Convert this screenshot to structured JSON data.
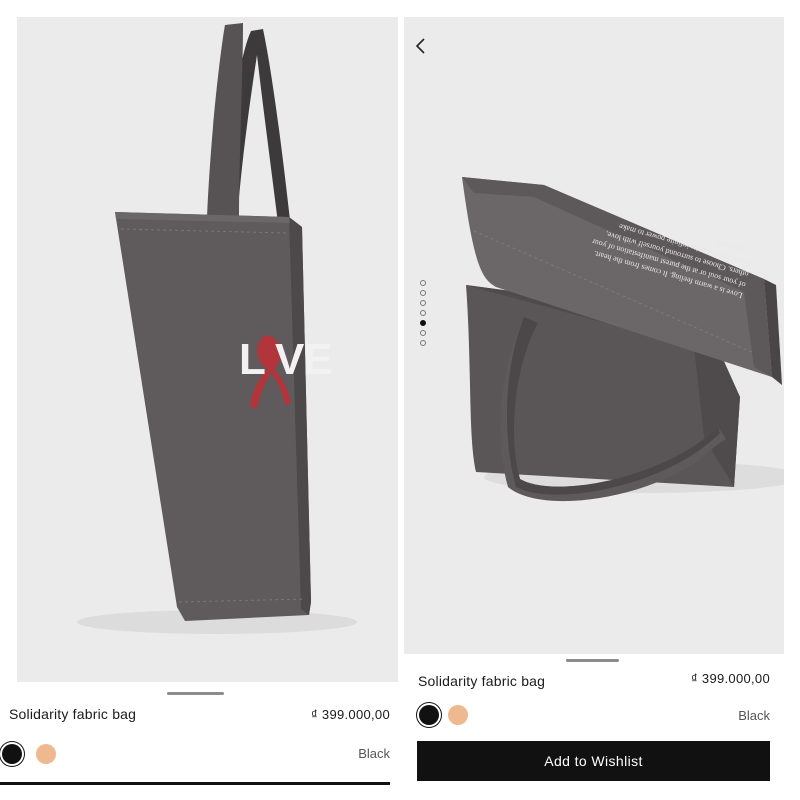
{
  "left": {
    "product": {
      "title": "Solidarity fabric bag",
      "price": "₫ 399.000,00",
      "selected_color": "Black"
    },
    "bag_print": {
      "letters_left": "L",
      "letters_right": "VE"
    },
    "swatches": [
      {
        "name": "black-swatch",
        "color": "#111111"
      },
      {
        "name": "peach-swatch",
        "color": "#EEB98F"
      }
    ]
  },
  "right": {
    "product": {
      "title": "Solidarity fabric bag",
      "price": "₫ 399.000,00",
      "selected_color": "Black"
    },
    "gallery": {
      "image_count": 7,
      "active_index": 5
    },
    "bag_text_lines": [
      "Love is a warm feeling. It comes from the heart.",
      "of your soul or at the purest manifestation of your",
      "others. Choose to surround yourself with love,",
      "it, and believe in its infinite power to make",
      "things better."
    ],
    "wishlist_button": {
      "label": "Add to Wishlist"
    }
  }
}
